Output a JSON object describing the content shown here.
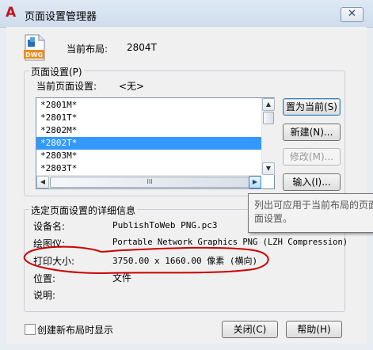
{
  "window": {
    "title": "页面设置管理器",
    "close_glyph": "✕"
  },
  "current_layout": {
    "label": "当前布局:",
    "value": "2804T",
    "icon_caption": "DWG"
  },
  "page_setups": {
    "group_title": "页面设置(P)",
    "current_label": "当前页面设置:",
    "current_value": "<无>",
    "items": [
      "*2801M*",
      "*2801T*",
      "*2802M*",
      "*2802T*",
      "*2803M*",
      "*2803T*"
    ],
    "selected_index": 3,
    "hscroll_grip": "III"
  },
  "buttons": {
    "set_current": "置为当前(S)",
    "new": "新建(N)...",
    "modify": "修改(M)...",
    "import": "输入(I)...",
    "close": "关闭(C)",
    "help": "帮助(H)"
  },
  "tooltip": {
    "line1": "列出可应用于当前布局的页面",
    "line2": "面设置。"
  },
  "details": {
    "group_title": "选定页面设置的详细信息",
    "device_label": "设备名:",
    "device_value": "PublishToWeb PNG.pc3",
    "plotter_label": "绘图仪:",
    "plotter_value": "Portable Network Graphics PNG (LZH Compression)",
    "size_label": "打印大小:",
    "size_value": "3750.00 x 1660.00 像素 (横向)",
    "location_label": "位置:",
    "location_value": "文件",
    "description_label": "说明:"
  },
  "checkbox": {
    "label": "创建新布局时显示",
    "checked": false
  },
  "colors": {
    "selection": "#3399ff",
    "annotation": "#cc0000",
    "app_icon": "#c0171c"
  }
}
